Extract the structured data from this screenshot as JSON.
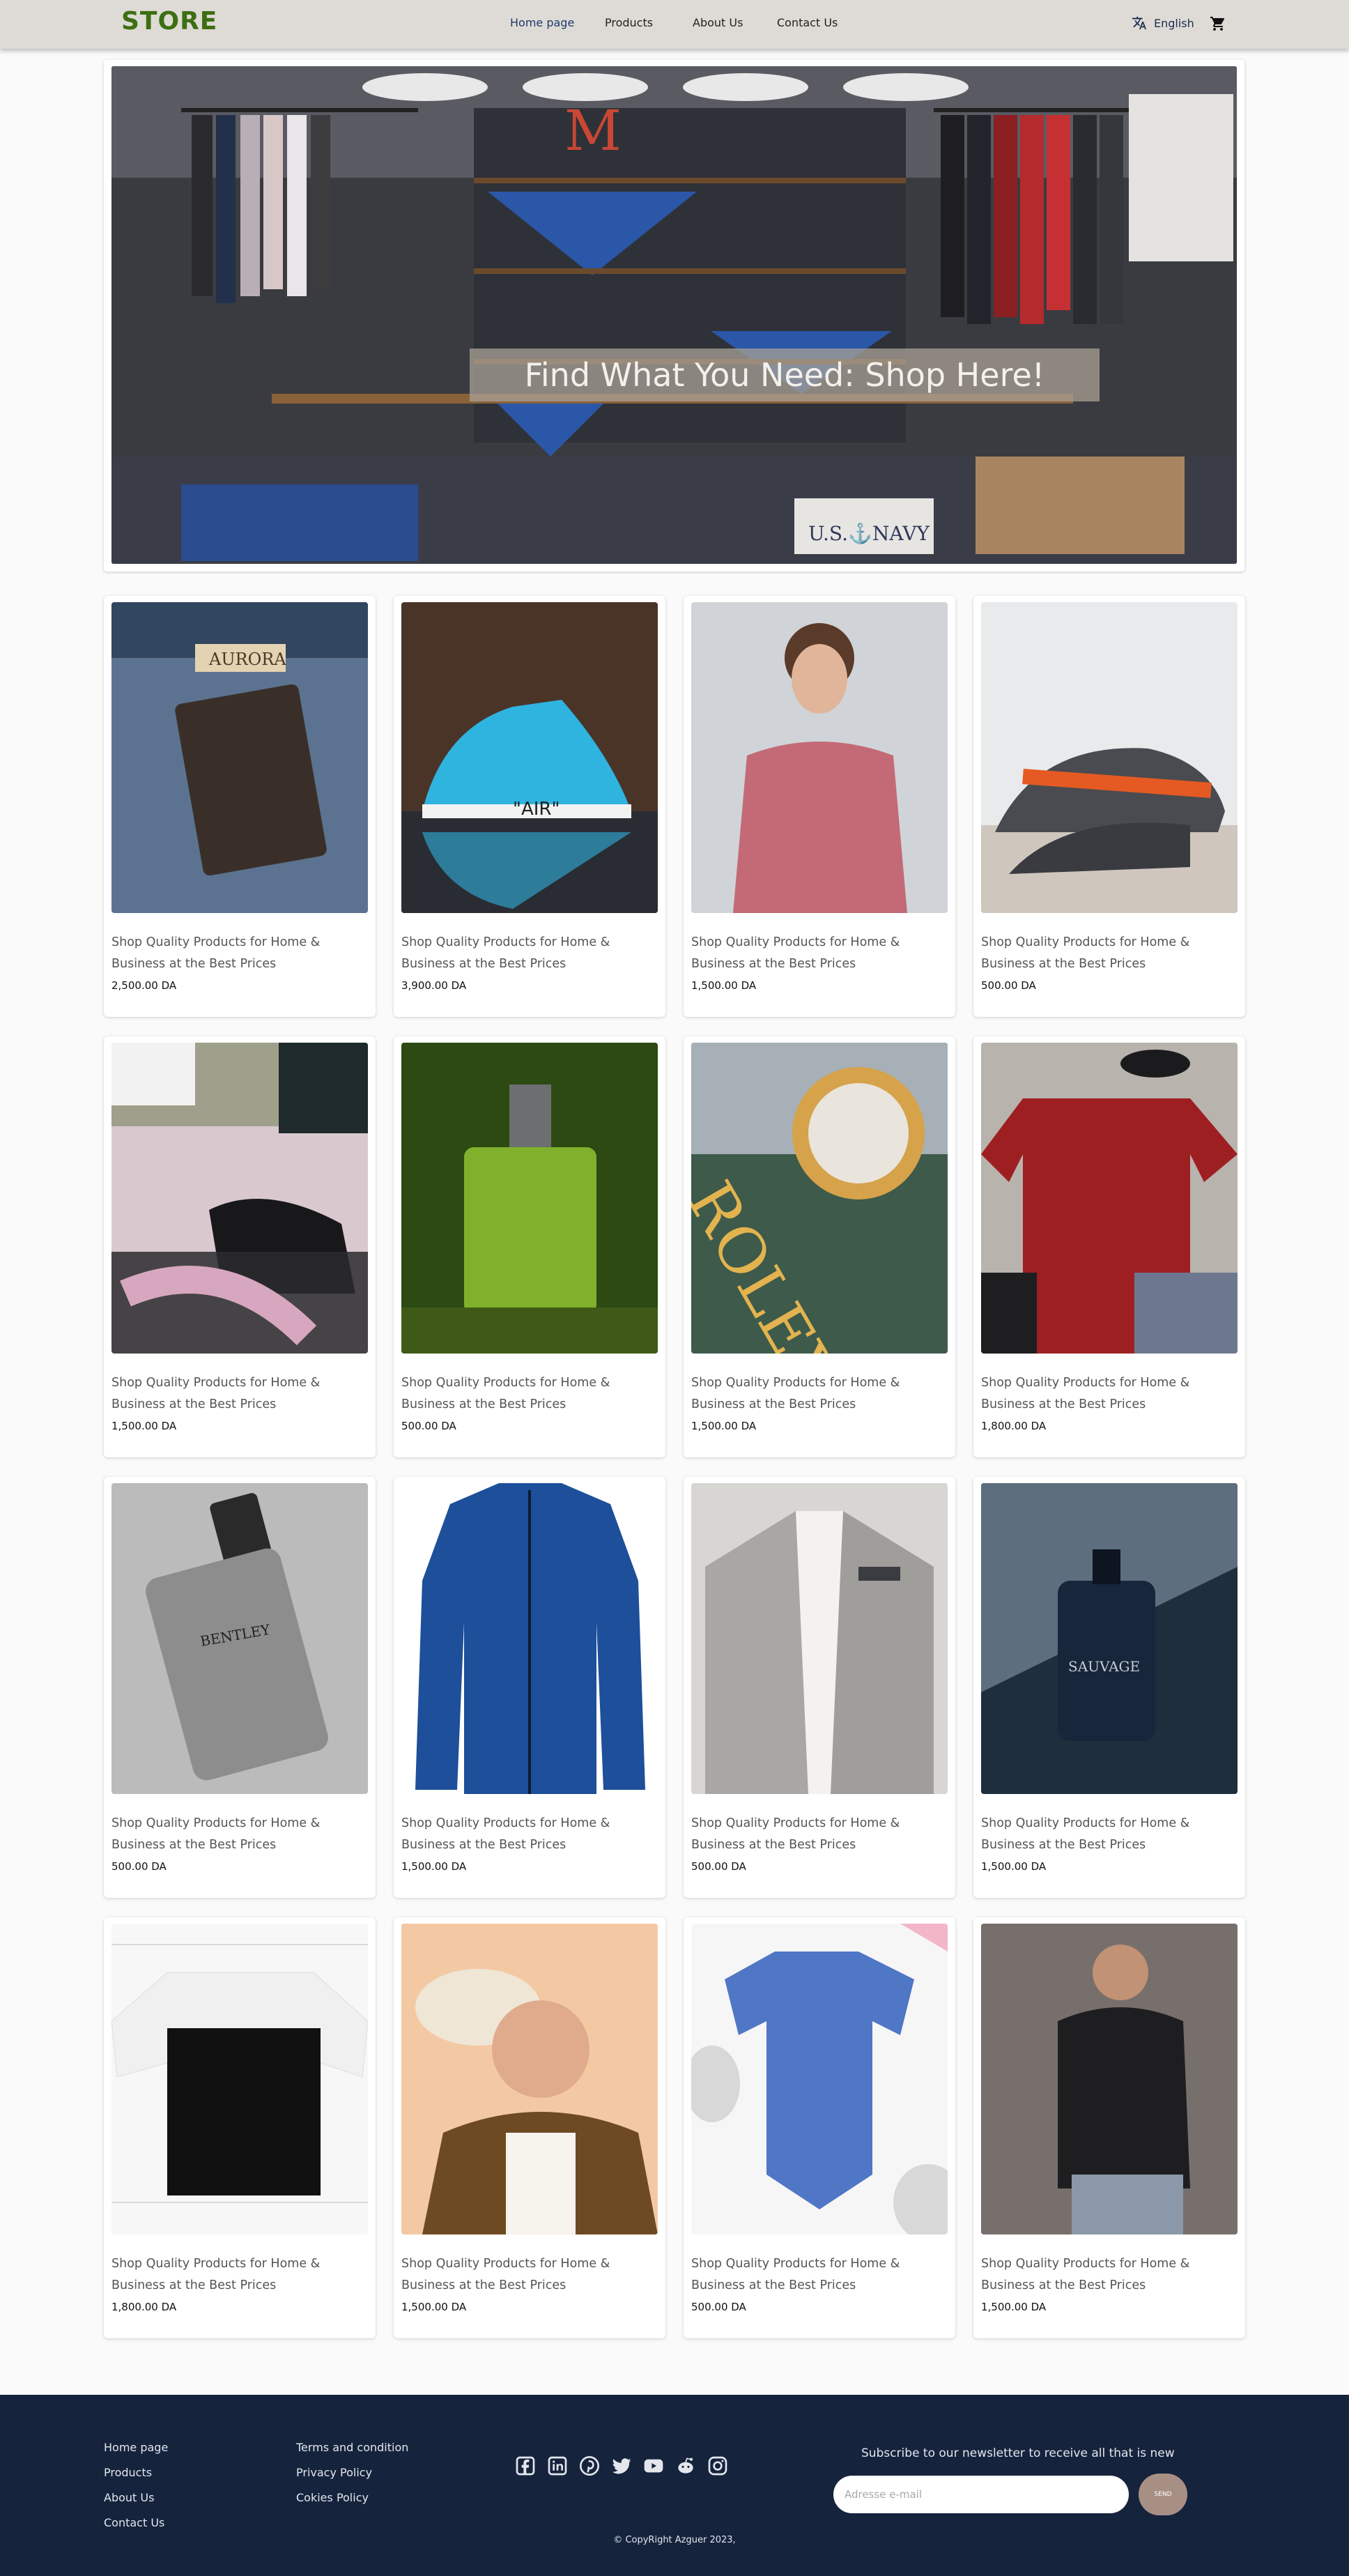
{
  "header": {
    "logo": "STORE",
    "nav": [
      "Home page",
      "Products",
      "About Us",
      "Contact Us"
    ],
    "language": "English"
  },
  "hero": {
    "title": "Find What You Need: Shop Here!"
  },
  "products": [
    {
      "desc": "Shop Quality Products for Home & Business at the Best Prices",
      "price": "2,500.00 DA",
      "image": "jeans-label"
    },
    {
      "desc": "Shop Quality Products for Home & Business at the Best Prices",
      "price": "3,900.00 DA",
      "image": "blue-sneaker"
    },
    {
      "desc": "Shop Quality Products for Home & Business at the Best Prices",
      "price": "1,500.00 DA",
      "image": "pink-tshirt-man"
    },
    {
      "desc": "Shop Quality Products for Home & Business at the Best Prices",
      "price": "500.00 DA",
      "image": "grey-orange-sneakers"
    },
    {
      "desc": "Shop Quality Products for Home & Business at the Best Prices",
      "price": "1,500.00 DA",
      "image": "black-shoe-lacing"
    },
    {
      "desc": "Shop Quality Products for Home & Business at the Best Prices",
      "price": "500.00 DA",
      "image": "green-perfume"
    },
    {
      "desc": "Shop Quality Products for Home & Business at the Best Prices",
      "price": "1,500.00 DA",
      "image": "gold-watch"
    },
    {
      "desc": "Shop Quality Products for Home & Business at the Best Prices",
      "price": "1,800.00 DA",
      "image": "red-tshirt-flatlay"
    },
    {
      "desc": "Shop Quality Products for Home & Business at the Best Prices",
      "price": "500.00 DA",
      "image": "bentley-perfume"
    },
    {
      "desc": "Shop Quality Products for Home & Business at the Best Prices",
      "price": "1,500.00 DA",
      "image": "blue-fleece-jacket"
    },
    {
      "desc": "Shop Quality Products for Home & Business at the Best Prices",
      "price": "500.00 DA",
      "image": "grey-blazer"
    },
    {
      "desc": "Shop Quality Products for Home & Business at the Best Prices",
      "price": "1,500.00 DA",
      "image": "sauvage-perfume"
    },
    {
      "desc": "Shop Quality Products for Home & Business at the Best Prices",
      "price": "1,800.00 DA",
      "image": "raglan-tshirt"
    },
    {
      "desc": "Shop Quality Products for Home & Business at the Best Prices",
      "price": "1,500.00 DA",
      "image": "man-with-hat"
    },
    {
      "desc": "Shop Quality Products for Home & Business at the Best Prices",
      "price": "500.00 DA",
      "image": "blue-bodysuit"
    },
    {
      "desc": "Shop Quality Products for Home & Business at the Best Prices",
      "price": "1,500.00 DA",
      "image": "black-sweater-man"
    }
  ],
  "footer": {
    "col1": [
      "Home page",
      "Products",
      "About Us",
      "Contact Us"
    ],
    "col2": [
      "Terms and condition",
      "Privacy Policy",
      "Cokies Policy"
    ],
    "socials": [
      "facebook-icon",
      "linkedin-icon",
      "pinterest-icon",
      "twitter-icon",
      "youtube-icon",
      "reddit-icon",
      "instagram-icon"
    ],
    "newsletter_title": "Subscribe to our newsletter to receive all that is new",
    "email_placeholder": "Adresse e-mail",
    "send_label": "SEND",
    "copyright": "© CopyRight Azguer 2023,"
  }
}
